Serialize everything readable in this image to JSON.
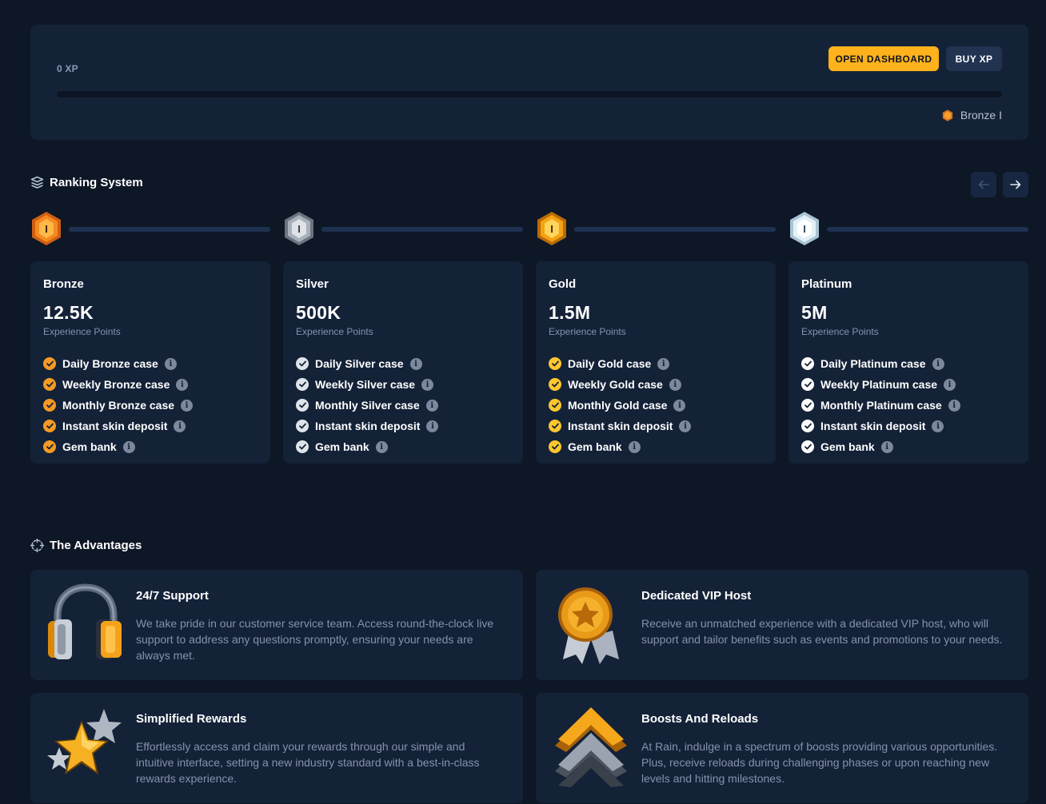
{
  "xp_panel": {
    "xp_text": "0 XP",
    "progress": 0,
    "open_dashboard_label": "OPEN DASHBOARD",
    "buy_xp_label": "BUY XP",
    "current_rank": "Bronze I",
    "current_rank_icon": "bronze-badge-icon"
  },
  "ranking": {
    "title": "Ranking System",
    "title_icon": "layers-icon",
    "prev_icon": "arrow-left-icon",
    "next_icon": "arrow-right-icon",
    "badge_numeral": "I",
    "tiers": [
      {
        "name": "Bronze",
        "xp": "12.5K",
        "xp_label": "Experience Points",
        "check_color": "#f59a23",
        "benefits": [
          "Daily Bronze case",
          "Weekly Bronze case",
          "Monthly Bronze case",
          "Instant skin deposit",
          "Gem bank"
        ]
      },
      {
        "name": "Silver",
        "xp": "500K",
        "xp_label": "Experience Points",
        "check_color": "#dfe4ea",
        "benefits": [
          "Daily Silver case",
          "Weekly Silver case",
          "Monthly Silver case",
          "Instant skin deposit",
          "Gem bank"
        ]
      },
      {
        "name": "Gold",
        "xp": "1.5M",
        "xp_label": "Experience Points",
        "check_color": "#ffc62e",
        "benefits": [
          "Daily Gold case",
          "Weekly Gold case",
          "Monthly Gold case",
          "Instant skin deposit",
          "Gem bank"
        ]
      },
      {
        "name": "Platinum",
        "xp": "5M",
        "xp_label": "Experience Points",
        "check_color": "#ffffff",
        "benefits": [
          "Daily Platinum case",
          "Weekly Platinum case",
          "Monthly Platinum case",
          "Instant skin deposit",
          "Gem bank"
        ]
      }
    ]
  },
  "advantages": {
    "title": "The Advantages",
    "title_icon": "crosshair-icon",
    "items": [
      {
        "title": "24/7 Support",
        "icon": "headphones-icon",
        "description": "We take pride in our customer service team. Access round-the-clock live support to address any questions promptly, ensuring your needs are always met."
      },
      {
        "title": "Dedicated VIP Host",
        "icon": "medal-icon",
        "description": "Receive an unmatched experience with a dedicated VIP host, who will support and tailor benefits such as events and promotions to your needs."
      },
      {
        "title": "Simplified Rewards",
        "icon": "stars-icon",
        "description": "Effortlessly access and claim your rewards through our simple and intuitive interface, setting a new industry standard with a best-in-class rewards experience."
      },
      {
        "title": "Boosts And Reloads",
        "icon": "chevrons-up-icon",
        "description": "At Rain, indulge in a spectrum of boosts providing various opportunities. Plus, receive reloads during challenging phases or upon reaching new levels and hitting milestones."
      }
    ]
  },
  "colors": {
    "background": "#0d1726",
    "panel": "#142238",
    "accent": "#ffb21b",
    "muted_text": "#8593aa"
  }
}
